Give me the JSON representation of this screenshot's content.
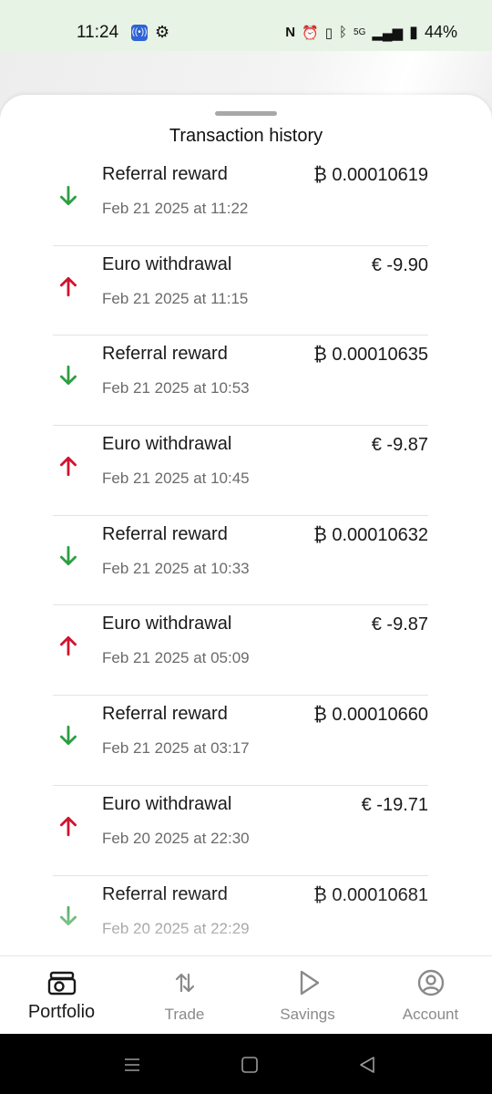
{
  "status_bar": {
    "time": "11:24",
    "network": "5G",
    "battery": "44%"
  },
  "sheet": {
    "title": "Transaction history"
  },
  "transactions": [
    {
      "type": "in",
      "title": "Referral reward",
      "date": "Feb 21 2025 at 11:22",
      "amount": "₿ 0.00010619"
    },
    {
      "type": "out",
      "title": "Euro withdrawal",
      "date": "Feb 21 2025 at 11:15",
      "amount": "€ -9.90"
    },
    {
      "type": "in",
      "title": "Referral reward",
      "date": "Feb 21 2025 at 10:53",
      "amount": "₿ 0.00010635"
    },
    {
      "type": "out",
      "title": "Euro withdrawal",
      "date": "Feb 21 2025 at 10:45",
      "amount": "€ -9.87"
    },
    {
      "type": "in",
      "title": "Referral reward",
      "date": "Feb 21 2025 at 10:33",
      "amount": "₿ 0.00010632"
    },
    {
      "type": "out",
      "title": "Euro withdrawal",
      "date": "Feb 21 2025 at 05:09",
      "amount": "€ -9.87"
    },
    {
      "type": "in",
      "title": "Referral reward",
      "date": "Feb 21 2025 at 03:17",
      "amount": "₿ 0.00010660"
    },
    {
      "type": "out",
      "title": "Euro withdrawal",
      "date": "Feb 20 2025 at 22:30",
      "amount": "€ -19.71"
    },
    {
      "type": "in",
      "title": "Referral reward",
      "date": "Feb 20 2025 at 22:29",
      "amount": "₿ 0.00010681"
    }
  ],
  "bottom_nav": {
    "items": [
      {
        "label": "Portfolio",
        "icon": "portfolio-icon",
        "active": true
      },
      {
        "label": "Trade",
        "icon": "trade-icon",
        "active": false
      },
      {
        "label": "Savings",
        "icon": "savings-icon",
        "active": false
      },
      {
        "label": "Account",
        "icon": "account-icon",
        "active": false
      }
    ]
  },
  "colors": {
    "incoming": "#2e9e44",
    "outgoing": "#d0132f",
    "status_bar_bg": "#e7f3e4"
  }
}
